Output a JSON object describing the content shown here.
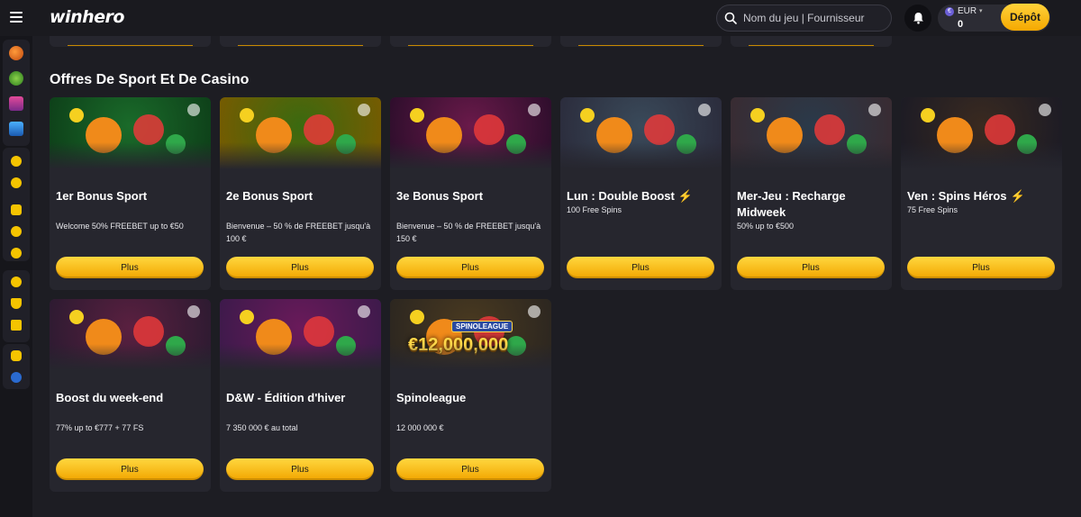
{
  "header": {
    "logo": "winhero",
    "search_placeholder": "Nom du jeu | Fournisseur",
    "currency_symbol": "€",
    "currency_code": "EUR",
    "balance": "0",
    "deposit_label": "Dépôt"
  },
  "section": {
    "title": "Offres De Sport Et De Casino"
  },
  "offers": [
    {
      "title": "1er Bonus Sport",
      "subtitle": "Welcome 50% FREEBET up to €50",
      "bolt": false,
      "button": "Plus",
      "art_colors": [
        "#1a6b2a",
        "#0d3d18"
      ]
    },
    {
      "title": "2e Bonus Sport",
      "subtitle": "Bienvenue – 50 % de FREEBET jusqu'à 100 €",
      "bolt": false,
      "button": "Plus",
      "art_colors": [
        "#3a6a10",
        "#7a5a00"
      ]
    },
    {
      "title": "3e Bonus Sport",
      "subtitle": "Bienvenue – 50 % de FREEBET jusqu'à 150 €",
      "bolt": false,
      "button": "Plus",
      "art_colors": [
        "#6a1a4a",
        "#2a0d2a"
      ]
    },
    {
      "title": "Lun : Double Boost",
      "subtitle": "100 Free Spins",
      "bolt": true,
      "button": "Plus",
      "art_colors": [
        "#3a4a5a",
        "#2a2a3a"
      ]
    },
    {
      "title": "Mer-Jeu : Recharge Midweek",
      "subtitle": "50% up to €500",
      "bolt": false,
      "button": "Plus",
      "art_colors": [
        "#2a3a4a",
        "#3a2a30"
      ]
    },
    {
      "title": "Ven : Spins Héros",
      "subtitle": "75 Free Spins",
      "bolt": true,
      "button": "Plus",
      "art_colors": [
        "#3a2a20",
        "#1a1a25"
      ]
    },
    {
      "title": "Boost du week-end",
      "subtitle": "77% up to €777 + 77 FS",
      "bolt": false,
      "button": "Plus",
      "art_colors": [
        "#5a2040",
        "#2a1a30"
      ]
    },
    {
      "title": "D&W - Édition d'hiver",
      "subtitle": "7 350 000 € au total",
      "bolt": false,
      "button": "Plus",
      "art_colors": [
        "#6a1a5a",
        "#3a1a4a"
      ]
    },
    {
      "title": "Spinoleague",
      "subtitle": "12 000 000 €",
      "bolt": false,
      "button": "Plus",
      "art_colors": [
        "#4a3a20",
        "#2a2520"
      ],
      "art_text": "€12,000,000",
      "art_badge": "SPINOLEAGUE"
    }
  ],
  "colors": {
    "accent": "#f5b800",
    "bolt": "#ff7a1a",
    "card_bg": "#26262e"
  }
}
